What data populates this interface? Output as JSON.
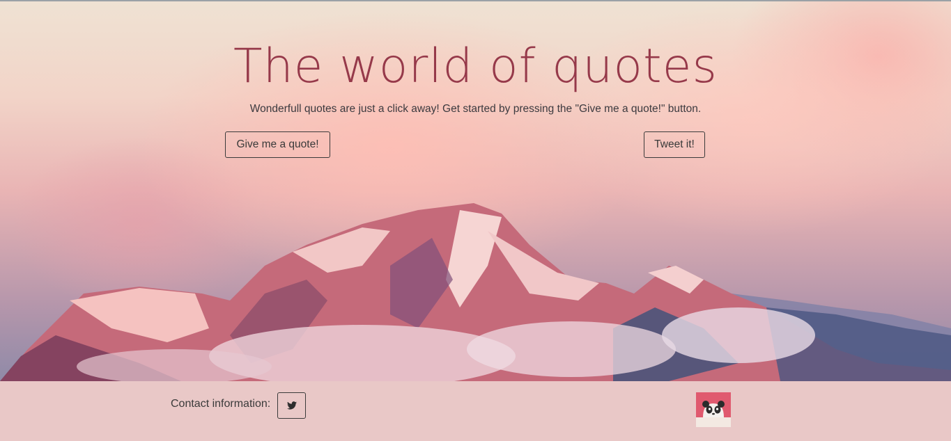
{
  "hero": {
    "title": "The world of quotes",
    "subtitle": "Wonderfull quotes are just a click away! Get started by pressing the \"Give me a quote!\" button.",
    "quote_button_label": "Give me a quote!",
    "tweet_button_label": "Tweet it!"
  },
  "footer": {
    "contact_label": "Contact information:",
    "twitter_icon": "twitter-icon",
    "avatar_icon": "panda-avatar"
  },
  "colors": {
    "title": "#96394a",
    "footer_bg": "#e9c8c7",
    "text": "#3a3a3a"
  }
}
